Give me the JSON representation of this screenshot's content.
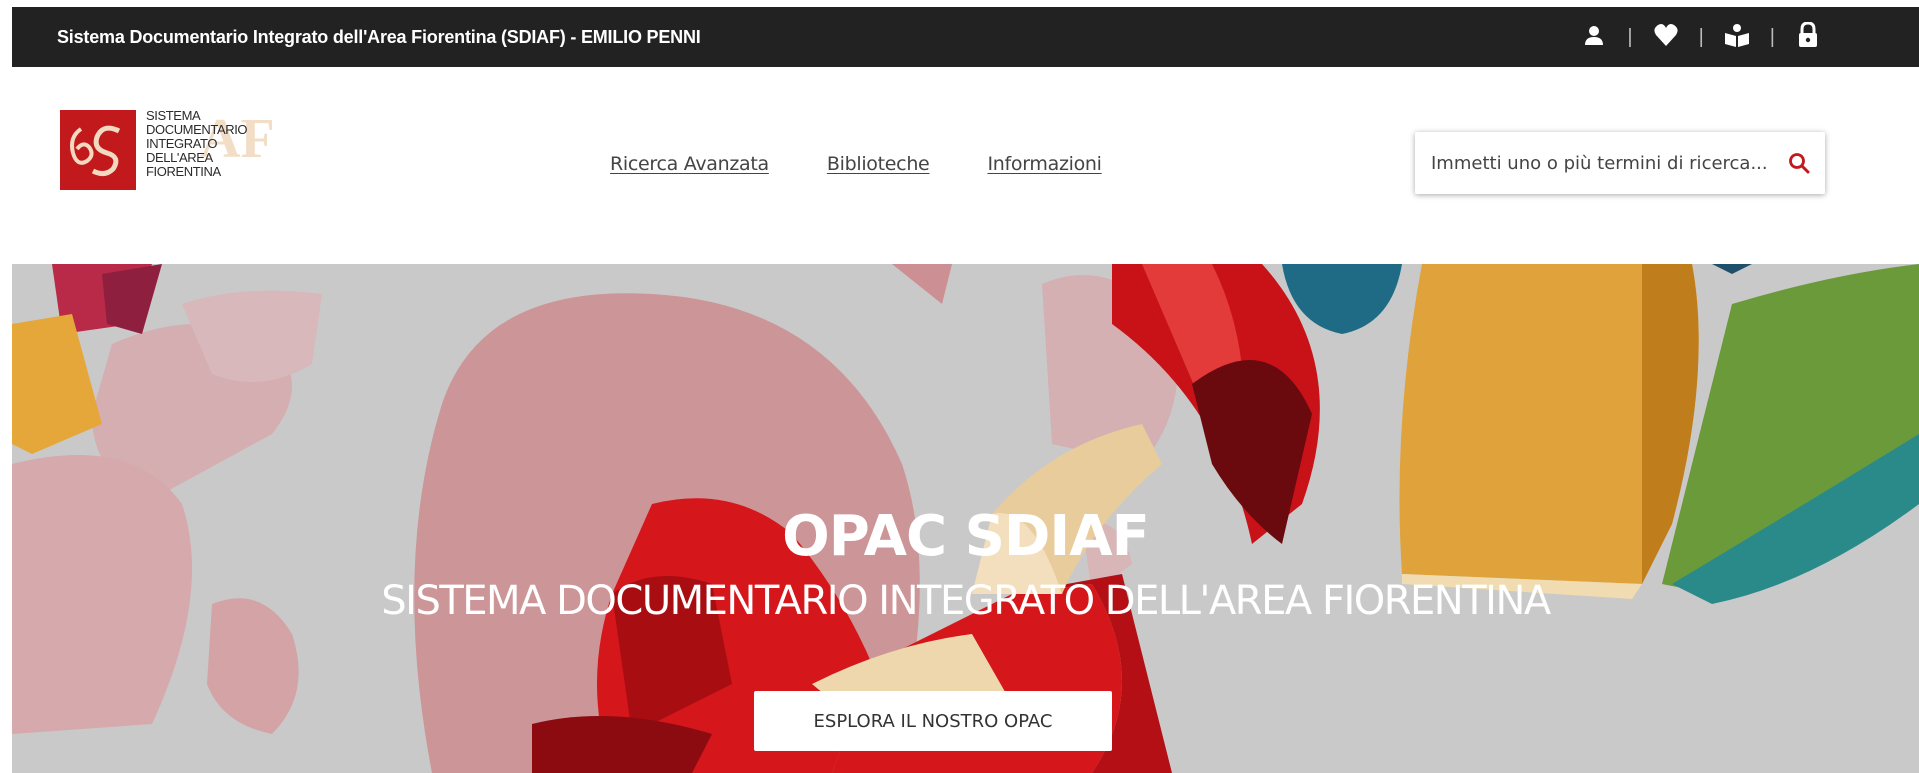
{
  "topbar": {
    "title": "Sistema Documentario Integrato dell'Area Fiorentina (SDIAF) - EMILIO PENNI",
    "icons": [
      "user-icon",
      "heart-icon",
      "reader-icon",
      "lock-icon"
    ]
  },
  "logo": {
    "lines": [
      "SISTEMA",
      "DOCUMENTARIO",
      "INTEGRATO",
      "DELL'AREA",
      "FIORENTINA"
    ],
    "mark": "S",
    "watermark": "AF"
  },
  "nav": {
    "items": [
      "Ricerca Avanzata",
      "Biblioteche",
      "Informazioni"
    ]
  },
  "search": {
    "placeholder": "Immetti uno o più termini di ricerca...",
    "icon": "search-icon"
  },
  "hero": {
    "title": "OPAC SDIAF",
    "subtitle": "SISTEMA DOCUMENTARIO INTEGRATO DELL'AREA FIORENTINA",
    "button_label": "ESPLORA IL NOSTRO OPAC"
  },
  "colors": {
    "topbar_bg": "#222222",
    "accent": "#c21a1c",
    "hero_bg": "#c9c9c9"
  }
}
